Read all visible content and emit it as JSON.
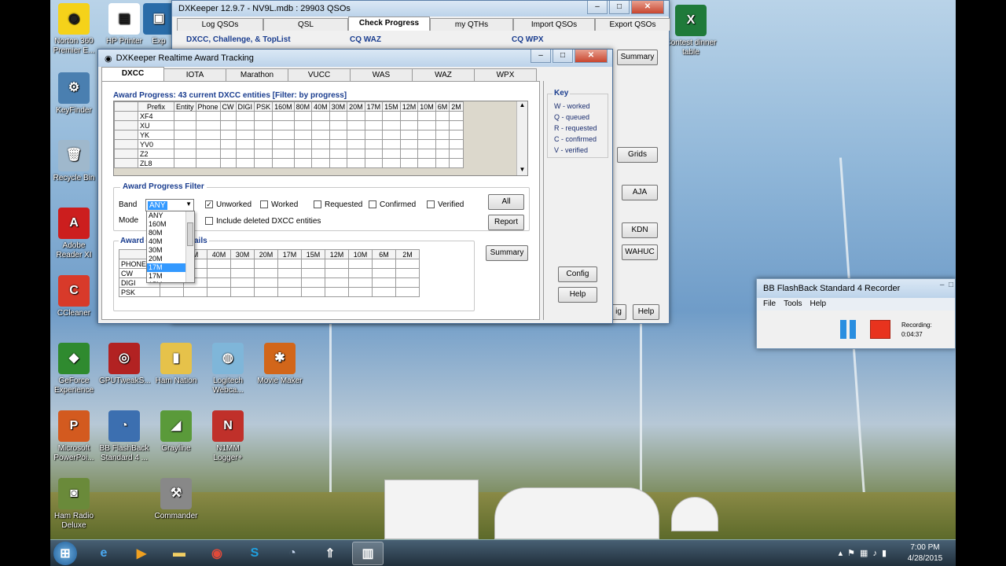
{
  "desktop": {
    "icons": [
      {
        "label": "Norton 360 Premier E...",
        "glyph": "◉",
        "color": "#f5d21a"
      },
      {
        "label": "HP Printer",
        "glyph": "▤",
        "color": "#ffffff"
      },
      {
        "label": "Exp",
        "glyph": "▣",
        "color": "#2a6ca8"
      },
      {
        "label": "KeyFinder",
        "glyph": "⚙",
        "color": "#4a7fb0"
      },
      {
        "label": "Recycle Bin",
        "glyph": "🗑",
        "color": "#9fb8cc"
      },
      {
        "label": "Adobe Reader XI",
        "glyph": "A",
        "color": "#cc1e1e"
      },
      {
        "label": "CCleaner",
        "glyph": "C",
        "color": "#d83a2a"
      },
      {
        "label": "GeForce Experience",
        "glyph": "◆",
        "color": "#2f8a2f"
      },
      {
        "label": "GPUTweakS...",
        "glyph": "◎",
        "color": "#b22222"
      },
      {
        "label": "Ham Nation",
        "glyph": "▮",
        "color": "#e6c24a"
      },
      {
        "label": "Logitech Webca...",
        "glyph": "◍",
        "color": "#7fb6d9"
      },
      {
        "label": "Movie Maker",
        "glyph": "✱",
        "color": "#d2661a"
      },
      {
        "label": "Microsoft PowerPoi...",
        "glyph": "P",
        "color": "#d35a1f"
      },
      {
        "label": "BB FlashBack Standard 4 ...",
        "glyph": "◔",
        "color": "#3c6fb0"
      },
      {
        "label": "Grayline",
        "glyph": "◢",
        "color": "#5a9a3a"
      },
      {
        "label": "N1MM Logger+",
        "glyph": "N",
        "color": "#c0302a"
      },
      {
        "label": "Ham Radio Deluxe",
        "glyph": "◙",
        "color": "#6a8a3a"
      },
      {
        "label": "Commander",
        "glyph": "⚒",
        "color": "#888888"
      },
      {
        "label": "Contest dinner table",
        "glyph": "X",
        "color": "#1f7a3a"
      }
    ]
  },
  "main_window": {
    "title": "DXKeeper 12.9.7 - NV9L.mdb : 29903 QSOs",
    "tabs": [
      "Log QSOs",
      "QSL",
      "Check Progress",
      "my QTHs",
      "Import QSOs",
      "Export QSOs"
    ],
    "active_tab": "Check Progress",
    "group_titles": [
      "DXCC, Challenge, & TopList",
      "CQ WAZ",
      "CQ WPX"
    ],
    "buttons": [
      "Summary",
      "Grids",
      "AJA",
      "KDN",
      "WAHUC",
      "Help",
      "ig"
    ]
  },
  "award_window": {
    "title": "DXKeeper Realtime Award Tracking",
    "tabs": [
      "DXCC",
      "IOTA",
      "Marathon",
      "VUCC",
      "WAS",
      "WAZ",
      "WPX"
    ],
    "active_tab": "DXCC",
    "progress_title": "Award Progress: 43 current DXCC entities [Filter: by progress]",
    "progress_columns": [
      "Prefix",
      "Entity",
      "Phone",
      "CW",
      "DIGI",
      "PSK",
      "160M",
      "80M",
      "40M",
      "30M",
      "20M",
      "17M",
      "15M",
      "12M",
      "10M",
      "6M",
      "2M"
    ],
    "progress_rows": [
      "XF4",
      "XU",
      "YK",
      "YV0",
      "Z2",
      "ZL8"
    ],
    "filter_title": "Award Progress Filter",
    "band_label": "Band",
    "band_value": "ANY",
    "mode_label": "Mode",
    "band_options": [
      "ANY",
      "160M",
      "80M",
      "40M",
      "30M",
      "20M",
      "17M",
      "15M"
    ],
    "highlighted_option": "17M",
    "checkboxes": [
      {
        "label": "Unworked",
        "checked": true
      },
      {
        "label": "Worked",
        "checked": false
      },
      {
        "label": "Requested",
        "checked": false
      },
      {
        "label": "Confirmed",
        "checked": false
      },
      {
        "label": "Verified",
        "checked": false
      }
    ],
    "include_deleted_label": "Include deleted DXCC entities",
    "all_button": "All",
    "report_button": "Report",
    "details_title_a": "Award",
    "details_title_b": "ails",
    "details_columns": [
      "M",
      "40M",
      "30M",
      "20M",
      "17M",
      "15M",
      "12M",
      "10M",
      "6M",
      "2M"
    ],
    "details_rows": [
      "PHONE",
      "CW",
      "DIGI",
      "PSK"
    ],
    "summary_button": "Summary",
    "key_title": "Key",
    "key_items": [
      "W - worked",
      "Q - queued",
      "R - requested",
      "C - confirmed",
      "V - verified"
    ],
    "config_button": "Config",
    "help_button": "Help"
  },
  "recorder": {
    "title": "BB FlashBack Standard 4 Recorder",
    "menu": [
      "File",
      "Tools",
      "Help"
    ],
    "status_label": "Recording:",
    "elapsed": "0:04:37"
  },
  "taskbar": {
    "time": "7:00 PM",
    "date": "4/28/2015"
  }
}
